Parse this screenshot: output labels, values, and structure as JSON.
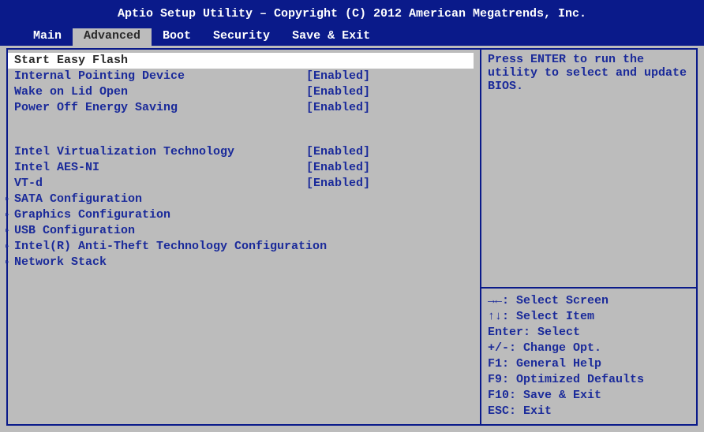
{
  "header": {
    "title": "Aptio Setup Utility – Copyright (C) 2012 American Megatrends, Inc."
  },
  "tabs": {
    "t0": "Main",
    "t1": "Advanced",
    "t2": "Boot",
    "t3": "Security",
    "t4": "Save & Exit",
    "activeIndex": 1
  },
  "menu": {
    "item0": {
      "label": "Start Easy Flash",
      "value": ""
    },
    "item1": {
      "label": "Internal Pointing Device",
      "value": "[Enabled]"
    },
    "item2": {
      "label": "Wake on Lid Open",
      "value": "[Enabled]"
    },
    "item3": {
      "label": "Power Off Energy Saving",
      "value": "[Enabled]"
    },
    "item4": {
      "label": "Intel Virtualization Technology",
      "value": "[Enabled]"
    },
    "item5": {
      "label": "Intel AES-NI",
      "value": "[Enabled]"
    },
    "item6": {
      "label": "VT-d",
      "value": "[Enabled]"
    },
    "item7": {
      "label": "SATA Configuration"
    },
    "item8": {
      "label": "Graphics Configuration"
    },
    "item9": {
      "label": "USB Configuration"
    },
    "item10": {
      "label": "Intel(R) Anti-Theft Technology Configuration"
    },
    "item11": {
      "label": "Network Stack"
    }
  },
  "help": {
    "text": "Press ENTER to run the utility to select and update BIOS.",
    "k0": "→←: Select Screen",
    "k1": "↑↓: Select Item",
    "k2": "Enter: Select",
    "k3": "+/-: Change Opt.",
    "k4": "F1: General Help",
    "k5": "F9: Optimized Defaults",
    "k6": "F10: Save & Exit",
    "k7": "ESC: Exit"
  }
}
